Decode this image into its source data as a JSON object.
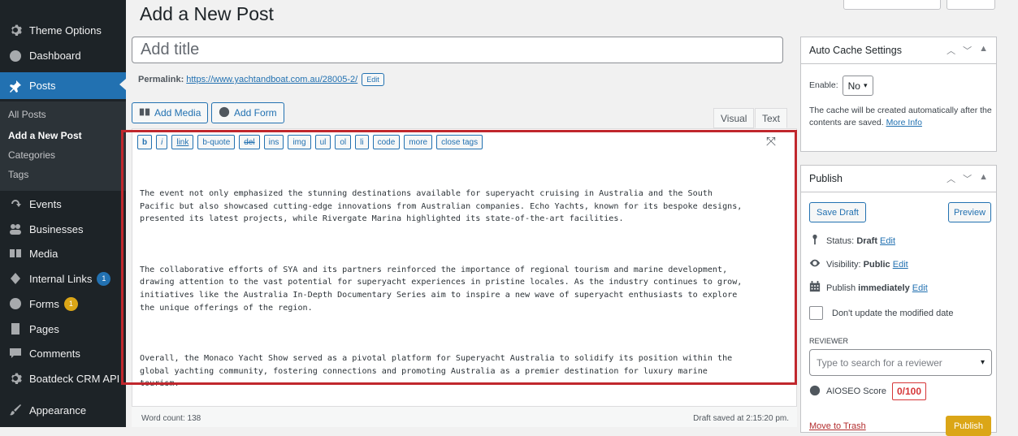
{
  "sidebar": {
    "items": [
      {
        "label": "Theme Options",
        "icon": "gear-icon"
      },
      {
        "label": "Dashboard",
        "icon": "dashboard-icon"
      },
      {
        "label": "Posts",
        "icon": "pin-icon"
      },
      {
        "label": "Events",
        "icon": "events-icon"
      },
      {
        "label": "Businesses",
        "icon": "businesses-icon"
      },
      {
        "label": "Media",
        "icon": "media-icon"
      },
      {
        "label": "Internal Links",
        "icon": "links-icon",
        "badge": "1"
      },
      {
        "label": "Forms",
        "icon": "forms-icon",
        "badge": "1"
      },
      {
        "label": "Pages",
        "icon": "pages-icon"
      },
      {
        "label": "Comments",
        "icon": "comments-icon"
      },
      {
        "label": "Boatdeck CRM API",
        "icon": "gear-icon"
      },
      {
        "label": "Appearance",
        "icon": "appearance-icon"
      }
    ],
    "submenu": [
      "All Posts",
      "Add a New Post",
      "Categories",
      "Tags"
    ]
  },
  "editor": {
    "page_title": "Add a New Post",
    "title_placeholder": "Add title",
    "permalink_label": "Permalink:",
    "permalink_url": "https://www.yachtandboat.com.au/28005-2/",
    "permalink_edit": "Edit",
    "add_media": "Add Media",
    "add_form": "Add Form",
    "tab_visual": "Visual",
    "tab_text": "Text",
    "quicktags": [
      "b",
      "i",
      "link",
      "b-quote",
      "del",
      "ins",
      "img",
      "ul",
      "ol",
      "li",
      "code",
      "more",
      "close tags"
    ],
    "content": [
      "The event not only emphasized the stunning destinations available for superyacht cruising in Australia and the South\nPacific but also showcased cutting-edge innovations from Australian companies. Echo Yachts, known for its bespoke designs,\npresented its latest projects, while Rivergate Marina highlighted its state-of-the-art facilities.",
      "The collaborative efforts of SYA and its partners reinforced the importance of regional tourism and marine development,\ndrawing attention to the vast potential for superyacht experiences in pristine locales. As the industry continues to grow,\ninitiatives like the Australia In-Depth Documentary Series aim to inspire a new wave of superyacht enthusiasts to explore\nthe unique offerings of the region.",
      "Overall, the Monaco Yacht Show served as a pivotal platform for Superyacht Australia to solidify its position within the\nglobal yachting community, fostering connections and promoting Australia as a premier destination for luxury marine\ntourism."
    ],
    "word_count": "Word count: 138",
    "draft_saved": "Draft saved at 2:15:20 pm."
  },
  "cache_box": {
    "title": "Auto Cache Settings",
    "enable_label": "Enable:",
    "enable_value": "No",
    "description": "The cache will be created automatically after the contents are saved.",
    "more_info": "More Info"
  },
  "publish_box": {
    "title": "Publish",
    "save_draft": "Save Draft",
    "preview": "Preview",
    "status_label": "Status:",
    "status_value": "Draft",
    "visibility_label": "Visibility:",
    "visibility_value": "Public",
    "publish_label": "Publish",
    "publish_value": "immediately",
    "edit": "Edit",
    "dont_update": "Don't update the modified date",
    "reviewer_heading": "REVIEWER",
    "reviewer_placeholder": "Type to search for a reviewer",
    "aioseo_label": "AIOSEO Score",
    "aioseo_score": "0/100",
    "move_to_trash": "Move to Trash",
    "publish_button": "Publish"
  }
}
